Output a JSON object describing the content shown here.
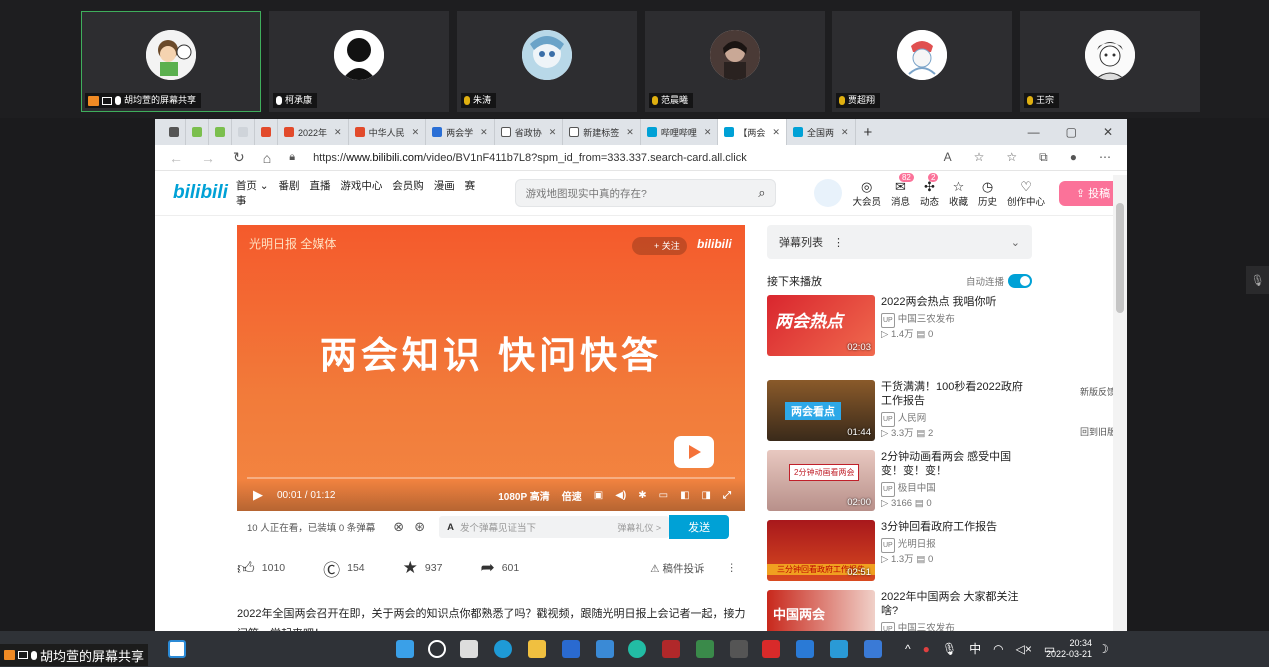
{
  "meeting": {
    "participants": [
      {
        "name": "胡均萱的屏幕共享",
        "avatar": "cartoon-boy",
        "active": true
      },
      {
        "name": "柯承康",
        "avatar": "silhouette",
        "active": false
      },
      {
        "name": "朱涛",
        "avatar": "anime-girl",
        "active": false
      },
      {
        "name": "范晨曦",
        "avatar": "dark-portrait",
        "active": false
      },
      {
        "name": "贾超翔",
        "avatar": "sketch-figure",
        "active": false
      },
      {
        "name": "王宗",
        "avatar": "manga-boy",
        "active": false
      }
    ],
    "share_label": "胡均萱的屏幕共享"
  },
  "browser": {
    "tabs": [
      {
        "label": ""
      },
      {
        "label": ""
      },
      {
        "label": ""
      },
      {
        "label": ""
      },
      {
        "label": ""
      },
      {
        "label": "2022年"
      },
      {
        "label": "中华人民"
      },
      {
        "label": "两会学"
      },
      {
        "label": "省政协"
      },
      {
        "label": "新建标签"
      },
      {
        "label": "哔哩哔哩"
      },
      {
        "label": "【两会"
      },
      {
        "label": "全国两"
      }
    ],
    "url_prefix": "https://",
    "url_host": "www.bilibili.com",
    "url_path": "/video/BV1nF411b7L8?spm_id_from=333.337.search-card.all.click"
  },
  "bili": {
    "logo": "bilibili",
    "nav": [
      "首页 ⌄",
      "番剧",
      "直播",
      "游戏中心",
      "会员购",
      "漫画",
      "赛事"
    ],
    "search_placeholder": "游戏地图现实中真的存在?",
    "icons": [
      {
        "label": "大会员",
        "icon": "vip-icon"
      },
      {
        "label": "消息",
        "icon": "message-icon",
        "badge": "82"
      },
      {
        "label": "动态",
        "icon": "dynamic-icon",
        "badge": "2"
      },
      {
        "label": "收藏",
        "icon": "star-icon"
      },
      {
        "label": "历史",
        "icon": "clock-icon"
      },
      {
        "label": "创作中心",
        "icon": "bulb-icon"
      }
    ],
    "upload_label": "投稿"
  },
  "player": {
    "brand": "光明日报 全媒体",
    "follow": "+ 关注",
    "watermark": "bilibili",
    "headline": "两会知识 快问快答",
    "time": "00:01 / 01:12",
    "quality": "1080P 高清",
    "speed": "倍速",
    "danmaku_info": "10 人正在看，已装填 0 条弹幕",
    "danmaku_placeholder": "发个弹幕见证当下",
    "danmaku_etiquette": "弹幕礼仪 >",
    "send": "发送"
  },
  "stats": {
    "like": "1010",
    "coin": "154",
    "fav": "937",
    "share": "601",
    "report": "稿件投诉"
  },
  "description": "2022年全国两会召开在即，关于两会的知识点你都熟悉了吗？戳视频，跟随光明日报上会记者一起，接力问答，学起来吧！",
  "sidebar": {
    "danmaku_list": "弹幕列表",
    "next_label": "接下来播放",
    "autoplay": "自动连播",
    "items": [
      {
        "title": "2022两会热点 我唱你听",
        "uploader": "中国三农发布",
        "views": "1.4万",
        "comments": "0",
        "duration": "02:03"
      },
      {
        "title": "干货满满！100秒看2022政府工作报告",
        "uploader": "人民网",
        "views": "3.3万",
        "comments": "2",
        "duration": "01:44"
      },
      {
        "title": "2分钟动画看两会 感受中国变！变！变！",
        "uploader": "极目中国",
        "views": "3166",
        "comments": "0",
        "duration": "02:00"
      },
      {
        "title": "3分钟回看政府工作报告",
        "uploader": "光明日报",
        "views": "1.3万",
        "comments": "0",
        "duration": "02:51"
      },
      {
        "title": "2022年中国两会 大家都关注啥?",
        "uploader": "中国三农发布",
        "views": "",
        "comments": "",
        "duration": ""
      }
    ],
    "feedback": "新版反馈",
    "back": "回到旧版"
  },
  "taskbar": {
    "time": "20:34",
    "date": "2022-03-21",
    "ime": "中"
  }
}
